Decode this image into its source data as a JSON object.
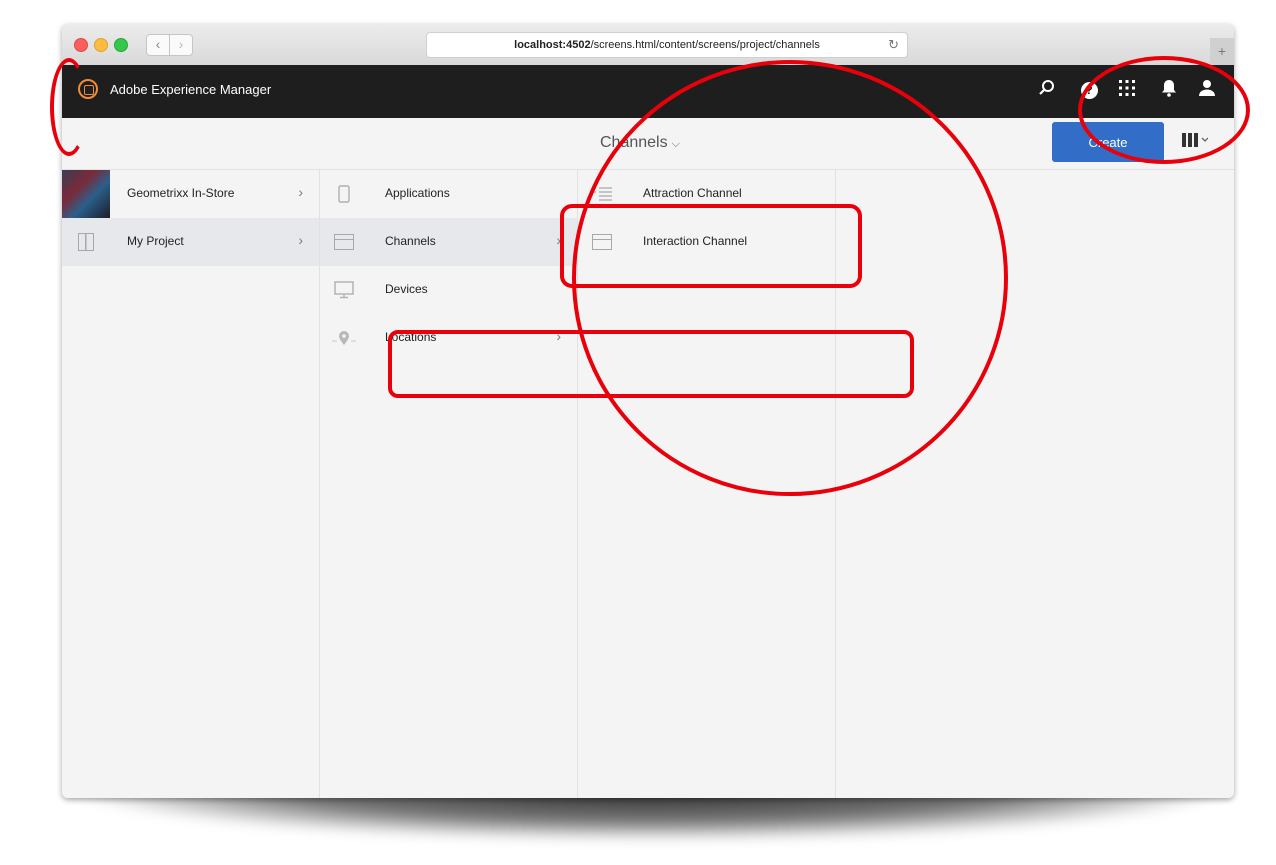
{
  "browser": {
    "url_host": "localhost:4502",
    "url_path": "/screens.html/content/screens/project/channels",
    "reload_glyph": "↻",
    "back_glyph": "‹",
    "forward_glyph": "›",
    "new_tab_glyph": "+"
  },
  "topbar": {
    "brand": "Adobe Experience Manager",
    "icons": [
      "search-icon",
      "help-icon",
      "apps-icon",
      "bell-icon",
      "user-icon"
    ]
  },
  "actionbar": {
    "title": "Channels",
    "create_label": "Create",
    "create_color": "#326ec8"
  },
  "columns": [
    {
      "items": [
        {
          "label": "Geometrixx In-Store",
          "icon": "thumbnail-photo",
          "has_children": true
        },
        {
          "label": "My Project",
          "icon": "grid-icon",
          "has_children": true,
          "selected": true
        }
      ]
    },
    {
      "items": [
        {
          "label": "Applications",
          "icon": "tablet-icon",
          "has_children": false
        },
        {
          "label": "Channels",
          "icon": "channel-icon",
          "has_children": true,
          "selected": true
        },
        {
          "label": "Devices",
          "icon": "monitor-icon",
          "has_children": false
        },
        {
          "label": "Locations",
          "icon": "location-pin-icon",
          "has_children": true
        }
      ]
    },
    {
      "items": [
        {
          "label": "Attraction Channel",
          "icon": "list-icon",
          "has_children": false
        },
        {
          "label": "Interaction Channel",
          "icon": "channel-icon",
          "has_children": false
        }
      ]
    }
  ],
  "colors": {
    "topbar": "#1e1e1e",
    "annotation": "#e8000a",
    "accent_logo": "#f08b3a"
  }
}
